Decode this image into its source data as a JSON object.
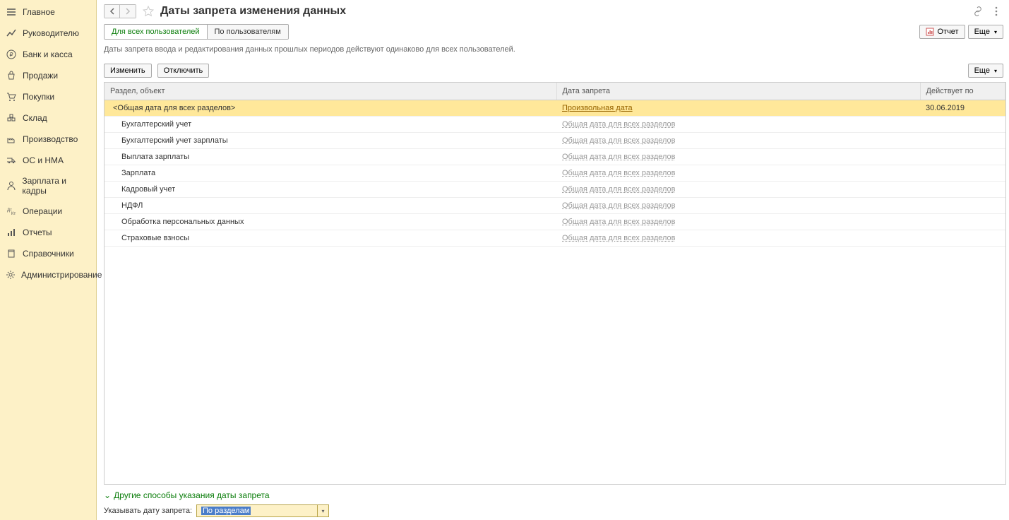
{
  "sidebar": {
    "items": [
      {
        "label": "Главное",
        "icon": "menu"
      },
      {
        "label": "Руководителю",
        "icon": "trend"
      },
      {
        "label": "Банк и касса",
        "icon": "ruble"
      },
      {
        "label": "Продажи",
        "icon": "bag"
      },
      {
        "label": "Покупки",
        "icon": "cart"
      },
      {
        "label": "Склад",
        "icon": "boxes"
      },
      {
        "label": "Производство",
        "icon": "factory"
      },
      {
        "label": "ОС и НМА",
        "icon": "truck"
      },
      {
        "label": "Зарплата и кадры",
        "icon": "person"
      },
      {
        "label": "Операции",
        "icon": "ops"
      },
      {
        "label": "Отчеты",
        "icon": "chart"
      },
      {
        "label": "Справочники",
        "icon": "book"
      },
      {
        "label": "Администрирование",
        "icon": "gear"
      }
    ]
  },
  "header": {
    "title": "Даты запрета изменения данных"
  },
  "tabs": [
    {
      "label": "Для всех пользователей",
      "active": true
    },
    {
      "label": "По пользователям",
      "active": false
    }
  ],
  "right_buttons": {
    "report": "Отчет",
    "more": "Еще"
  },
  "description": "Даты запрета ввода и редактирования данных прошлых периодов действуют одинаково для всех пользователей.",
  "toolbar": {
    "edit": "Изменить",
    "disable": "Отключить",
    "more": "Еще"
  },
  "table": {
    "columns": {
      "section": "Раздел, объект",
      "date": "Дата запрета",
      "valid": "Действует по"
    },
    "rows": [
      {
        "section": "<Общая дата для всех разделов>",
        "date": "Произвольная дата",
        "valid": "30.06.2019",
        "selected": true,
        "first": true
      },
      {
        "section": "Бухгалтерский учет",
        "date": "Общая дата для всех разделов",
        "valid": ""
      },
      {
        "section": "Бухгалтерский учет зарплаты",
        "date": "Общая дата для всех разделов",
        "valid": ""
      },
      {
        "section": "Выплата зарплаты",
        "date": "Общая дата для всех разделов",
        "valid": ""
      },
      {
        "section": "Зарплата",
        "date": "Общая дата для всех разделов",
        "valid": ""
      },
      {
        "section": "Кадровый учет",
        "date": "Общая дата для всех разделов",
        "valid": ""
      },
      {
        "section": "НДФЛ",
        "date": "Общая дата для всех разделов",
        "valid": ""
      },
      {
        "section": "Обработка персональных данных",
        "date": "Общая дата для всех разделов",
        "valid": ""
      },
      {
        "section": "Страховые взносы",
        "date": "Общая дата для всех разделов",
        "valid": ""
      }
    ]
  },
  "footer": {
    "collapse_title": "Другие способы указания даты запрета",
    "label": "Указывать дату запрета:",
    "select_value": "По разделам"
  }
}
